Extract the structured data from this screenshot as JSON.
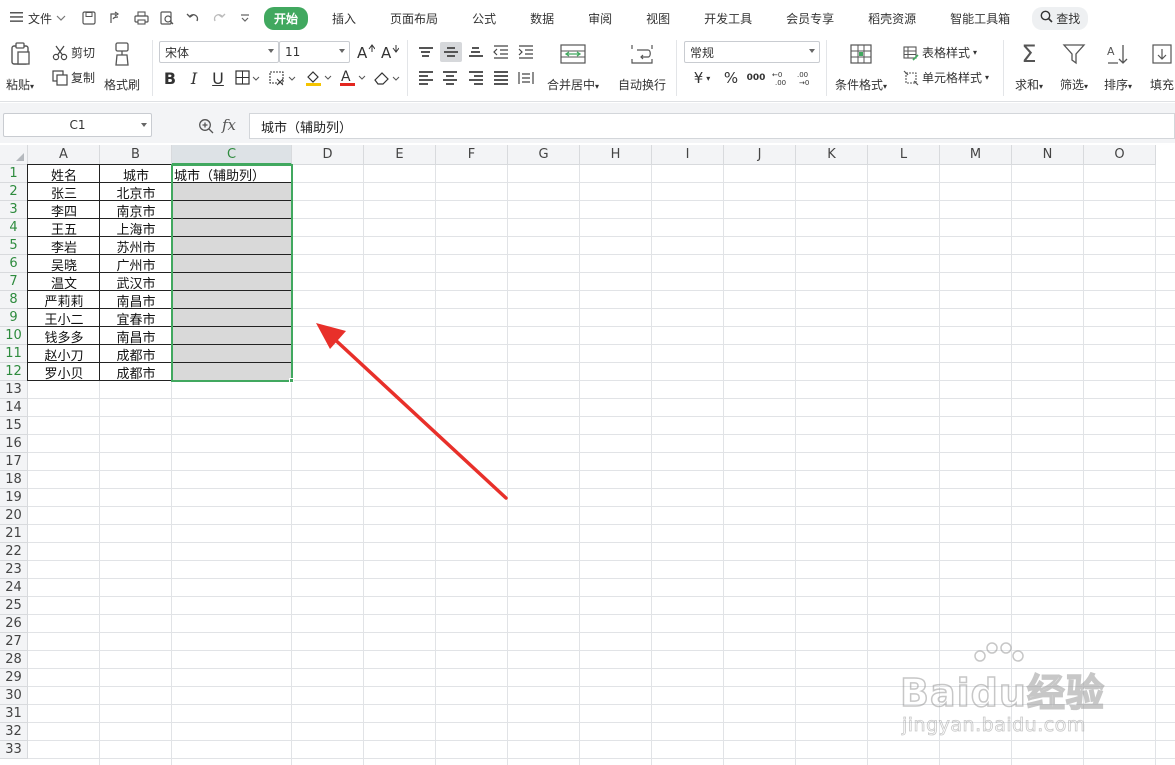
{
  "menubar": {
    "file": "文件",
    "tabs": [
      "开始",
      "插入",
      "页面布局",
      "公式",
      "数据",
      "审阅",
      "视图",
      "开发工具",
      "会员专享",
      "稻壳资源",
      "智能工具箱"
    ],
    "active_tab": "开始",
    "search": "查找"
  },
  "ribbon": {
    "paste": "粘贴",
    "cut": "剪切",
    "copy": "复制",
    "format_painter": "格式刷",
    "font_name": "宋体",
    "font_size": "11",
    "merge_center": "合并居中",
    "wrap_text": "自动换行",
    "number_format": "常规",
    "conditional_format": "条件格式",
    "table_style": "表格样式",
    "cell_style": "单元格样式",
    "sum": "求和",
    "filter": "筛选",
    "sort": "排序",
    "fill": "填充"
  },
  "formula_bar": {
    "name_box": "C1",
    "fx": "fx",
    "content": "城市（辅助列）"
  },
  "sheet": {
    "columns": [
      "A",
      "B",
      "C",
      "D",
      "E",
      "F",
      "G",
      "H",
      "I",
      "J",
      "K",
      "L",
      "M",
      "N",
      "O"
    ],
    "rows": [
      "1",
      "2",
      "3",
      "4",
      "5",
      "6",
      "7",
      "8",
      "9",
      "10",
      "11",
      "12",
      "13",
      "14",
      "15",
      "16",
      "17",
      "18",
      "19",
      "20",
      "21",
      "22",
      "23",
      "24",
      "25",
      "26",
      "27",
      "28",
      "29",
      "30",
      "31",
      "32",
      "33"
    ],
    "selected_col": "C",
    "selected_range": "C1:C12",
    "data": [
      [
        "姓名",
        "城市",
        "城市（辅助列）"
      ],
      [
        "张三",
        "北京市",
        ""
      ],
      [
        "李四",
        "南京市",
        ""
      ],
      [
        "王五",
        "上海市",
        ""
      ],
      [
        "李岩",
        "苏州市",
        ""
      ],
      [
        "吴晓",
        "广州市",
        ""
      ],
      [
        "温文",
        "武汉市",
        ""
      ],
      [
        "严莉莉",
        "南昌市",
        ""
      ],
      [
        "王小二",
        "宜春市",
        ""
      ],
      [
        "钱多多",
        "南昌市",
        ""
      ],
      [
        "赵小刀",
        "成都市",
        ""
      ],
      [
        "罗小贝",
        "成都市",
        ""
      ]
    ]
  },
  "colors": {
    "accent": "#41a85f",
    "annotation_arrow": "#e8302a",
    "selection_fill": "#d9d9d9"
  },
  "watermark": {
    "brand": "Baidu经验",
    "url": "jingyan.baidu.com"
  }
}
